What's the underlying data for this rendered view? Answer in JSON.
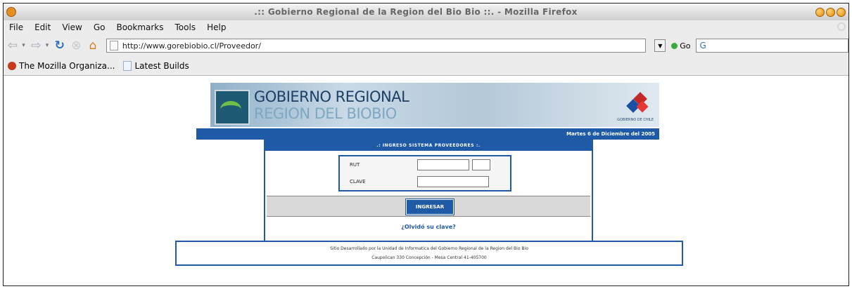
{
  "window": {
    "title": ".:: Gobierno Regional de la Region del Bio Bio ::. - Mozilla Firefox"
  },
  "menu": [
    "File",
    "Edit",
    "View",
    "Go",
    "Bookmarks",
    "Tools",
    "Help"
  ],
  "nav": {
    "url": "http://www.gorebiobio.cl/Proveedor/",
    "go_label": "Go"
  },
  "bookmarks": [
    {
      "label": "The Mozilla Organiza..."
    },
    {
      "label": "Latest Builds"
    }
  ],
  "page": {
    "banner_line1": "GOBIERNO REGIONAL",
    "banner_line2": "REGION DEL BIOBIO",
    "emblem_text": "GOBIERNO DE CHILE",
    "date": "Martes 6 de Diciembre del 2005",
    "login": {
      "header": ".: INGRESO SISTEMA PROVEEDORES :.",
      "rut_label": "RUT",
      "clave_label": "CLAVE",
      "submit_label": "INGRESAR",
      "forgot_label": "¿Olvidó su clave?"
    },
    "footer": {
      "line1": "Sitio Desarrollado por la Unidad de Informatica del Gobierno Regional de la Region del Bio Bio",
      "line2": "Caupolican 330 Concepción - Mesa Central 41-405700"
    }
  },
  "colors": {
    "accent": "#1f5aa6",
    "chrome": "#ececec",
    "orange": "#e58f1f"
  }
}
